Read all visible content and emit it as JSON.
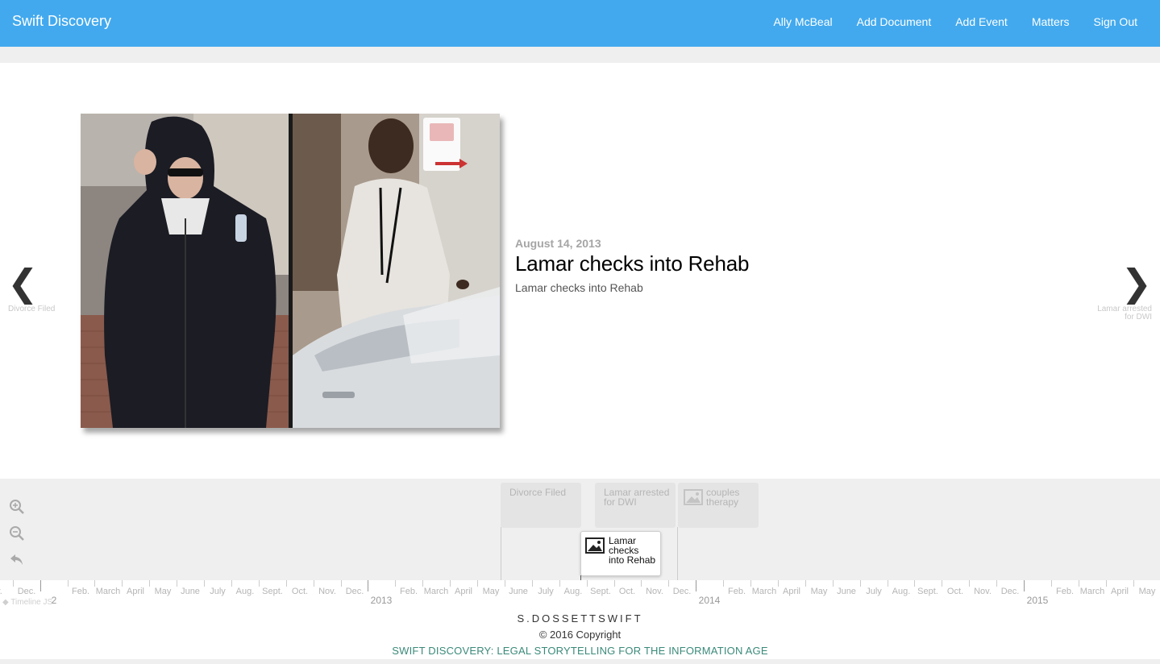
{
  "header": {
    "brand": "Swift Discovery",
    "nav": [
      "Ally McBeal",
      "Add Document",
      "Add Event",
      "Matters",
      "Sign Out"
    ],
    "color": "#42a9ee"
  },
  "slide": {
    "date": "August 14, 2013",
    "headline": "Lamar checks into Rehab",
    "description": "Lamar checks into Rehab",
    "prev_caption": "Divorce Filed",
    "next_caption_line1": "Lamar arrested",
    "next_caption_line2": "for DWI"
  },
  "timeline": {
    "markers": [
      {
        "lines": [
          "Divorce Filed"
        ],
        "has_thumb": false,
        "active": false
      },
      {
        "lines": [
          "Lamar arrested",
          "for DWI"
        ],
        "has_thumb": false,
        "active": false
      },
      {
        "lines": [
          "couples",
          "therapy"
        ],
        "has_thumb": true,
        "active": false
      },
      {
        "lines": [
          "Lamar",
          "checks",
          "into Rehab"
        ],
        "has_thumb": true,
        "active": true
      }
    ],
    "axis_labels": [
      "v.",
      "Dec.",
      "2",
      "Feb.",
      "March",
      "April",
      "May",
      "June",
      "July",
      "Aug.",
      "Sept.",
      "Oct.",
      "Nov.",
      "Dec.",
      "2013",
      "Feb.",
      "March",
      "April",
      "May",
      "June",
      "July",
      "Aug.",
      "Sept.",
      "Oct.",
      "Nov.",
      "Dec.",
      "2014",
      "Feb.",
      "March",
      "April",
      "May",
      "June",
      "July",
      "Aug.",
      "Sept.",
      "Oct.",
      "Nov.",
      "Dec.",
      "2015",
      "Feb.",
      "March",
      "April",
      "May"
    ],
    "credit": "Timeline JS"
  },
  "footer": {
    "line1": "S.DOSSETTSWIFT",
    "line2": "© 2016 Copyright",
    "line3": "SWIFT DISCOVERY: LEGAL STORYTELLING FOR THE INFORMATION AGE"
  }
}
